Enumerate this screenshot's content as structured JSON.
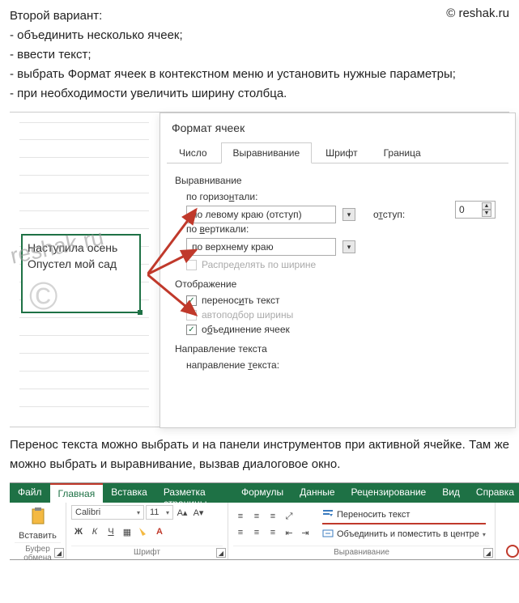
{
  "watermark": "© reshak.ru",
  "watermark2": "reshak.ru",
  "watermark_c": "©",
  "intro": {
    "heading": "Второй вариант:",
    "b1": "- объединить несколько ячеек;",
    "b2": "- ввести текст;",
    "b3": "- выбрать Формат ячеек в контекстном меню и установить нужные параметры;",
    "b4": "- при необходимости увеличить ширину столбца."
  },
  "cell": {
    "line1": "Наступила осень",
    "line2": "Опустел мой сад"
  },
  "dialog": {
    "title": "Формат ячеек",
    "tabs": {
      "number": "Число",
      "align": "Выравнивание",
      "font": "Шрифт",
      "border": "Граница"
    },
    "align": {
      "section": "Выравнивание",
      "horiz_label": "по горизонтали:",
      "horiz_value": "по левому краю (отступ)",
      "indent_label": "отступ:",
      "indent_value": "0",
      "vert_label": "по вертикали:",
      "vert_value": "по верхнему краю",
      "distribute": "Распределять по ширине"
    },
    "display": {
      "section": "Отображение",
      "wrap": "переносить текст",
      "autofit": "автоподбор ширины",
      "merge": "объединение ячеек"
    },
    "textdir": {
      "section": "Направление текста",
      "label": "направление текста:"
    }
  },
  "mid": "Перенос текста можно выбрать и на панели инструментов при активной ячейке. Там же можно выбрать и выравнивание, вызвав диалоговое окно.",
  "ribbon": {
    "tabs": {
      "file": "Файл",
      "home": "Главная",
      "insert": "Вставка",
      "layout": "Разметка страницы",
      "formulas": "Формулы",
      "data": "Данные",
      "review": "Рецензирование",
      "view": "Вид",
      "help": "Справка"
    },
    "clipboard": {
      "paste": "Вставить",
      "group": "Буфер обмена"
    },
    "font": {
      "name": "Calibri",
      "size": "11",
      "bold": "Ж",
      "italic": "К",
      "underline": "Ч",
      "group": "Шрифт"
    },
    "alignment": {
      "wrap": "Переносить текст",
      "merge": "Объединить и поместить в центре",
      "group": "Выравнивание"
    }
  }
}
